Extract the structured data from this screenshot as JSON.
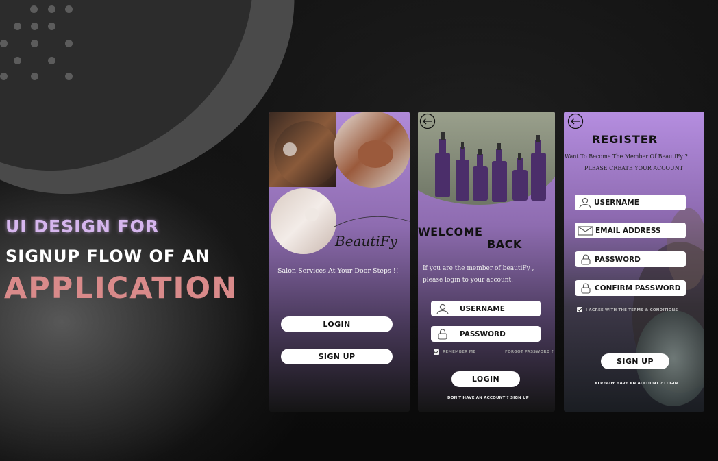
{
  "headline": {
    "line1": "UI DESIGN FOR",
    "line2": "SIGNUP FLOW OF AN",
    "line3": "APPLICATION"
  },
  "colors": {
    "accent_lavender": "#d6b6ee",
    "accent_rose": "#d98a8a",
    "phone_top": "#b08ad8",
    "phone_bottom": "#141414"
  },
  "landing": {
    "brand": "BeautiFy",
    "tagline": "Salon Services At Your Door Steps !!",
    "login_label": "LOGIN",
    "signup_label": "SIGN UP"
  },
  "login": {
    "title_line1": "WELCOME",
    "title_line2": "BACK",
    "intro_line1": "If you are the member of beautiFy ,",
    "intro_line2": "please login to your account.",
    "username_label": "USERNAME",
    "password_label": "PASSWORD",
    "remember_label": "REMEMBER ME",
    "forgot_label": "FORGOT PASSWORD ?",
    "login_label": "LOGIN",
    "footer": "DON'T HAVE AN ACCOUNT ? SIGN UP"
  },
  "register": {
    "title": "REGISTER",
    "subtitle": "Want To Become The Member Of BeautiFy ?",
    "subtitle2": "PLEASE CREATE YOUR ACCOUNT",
    "username_label": "USERNAME",
    "email_label": "EMAIL ADDRESS",
    "password_label": "PASSWORD",
    "confirm_label": "CONFIRM PASSWORD",
    "terms_label": "I AGREE WITH THE TERMS & CONDITIONS",
    "signup_label": "SIGN UP",
    "footer": "ALREADY HAVE AN ACCOUNT ? LOGIN"
  }
}
